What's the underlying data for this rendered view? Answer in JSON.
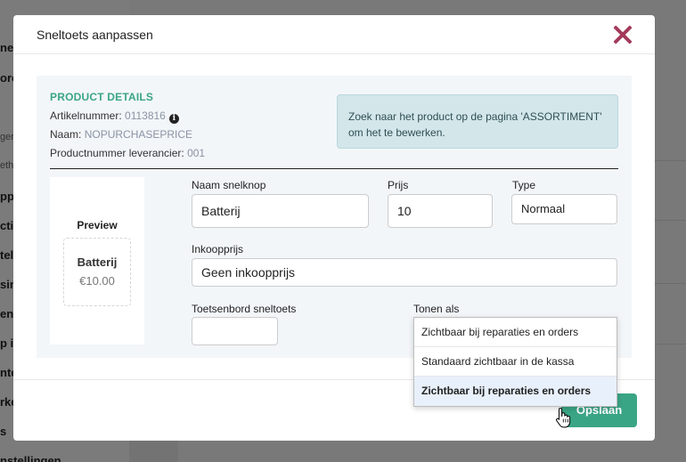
{
  "background": {
    "sidebar_fragments": [
      "ne",
      "ore",
      "ger",
      "eth",
      "pp",
      "ctio",
      "tel",
      "sin",
      "en",
      "p i",
      "nte",
      "rke",
      "s",
      "nstellingen"
    ]
  },
  "modal": {
    "title": "Sneltoets aanpassen",
    "close_icon": "close-x-icon"
  },
  "product_details": {
    "title": "PRODUCT DETAILS",
    "artikel_label": "Artikelnummer: ",
    "artikel_value": "0113816",
    "naam_label": "Naam: ",
    "naam_value": "NOPURCHASEPRICE",
    "leverancier_label": "Productnummer leverancier: ",
    "leverancier_value": "001",
    "info_icon": "i"
  },
  "notice": {
    "text": "Zoek naar het product op de pagina 'ASSORTIMENT' om het te bewerken."
  },
  "preview": {
    "label": "Preview",
    "name": "Batterij",
    "price": "€10.00"
  },
  "form": {
    "naam_label": "Naam snelknop",
    "naam_value": "Batterij",
    "prijs_label": "Prijs",
    "prijs_value": "10",
    "type_label": "Type",
    "type_value": "Normaal",
    "inkoop_label": "Inkoopprijs",
    "inkoop_value": "Geen inkoopprijs",
    "toets_label": "Toetsenbord sneltoets",
    "toets_value": "",
    "tonen_label": "Tonen als"
  },
  "dropdown": {
    "options": [
      "Zichtbaar bij reparaties en orders",
      "Standaard zichtbaar in de kassa",
      "Zichtbaar bij reparaties en orders"
    ],
    "highlighted_index": 2
  },
  "footer": {
    "save_label": "Opslaan"
  },
  "colors": {
    "accent": "#3aa585",
    "close": "#a33a5b",
    "notice_bg": "#d3e6ea"
  }
}
